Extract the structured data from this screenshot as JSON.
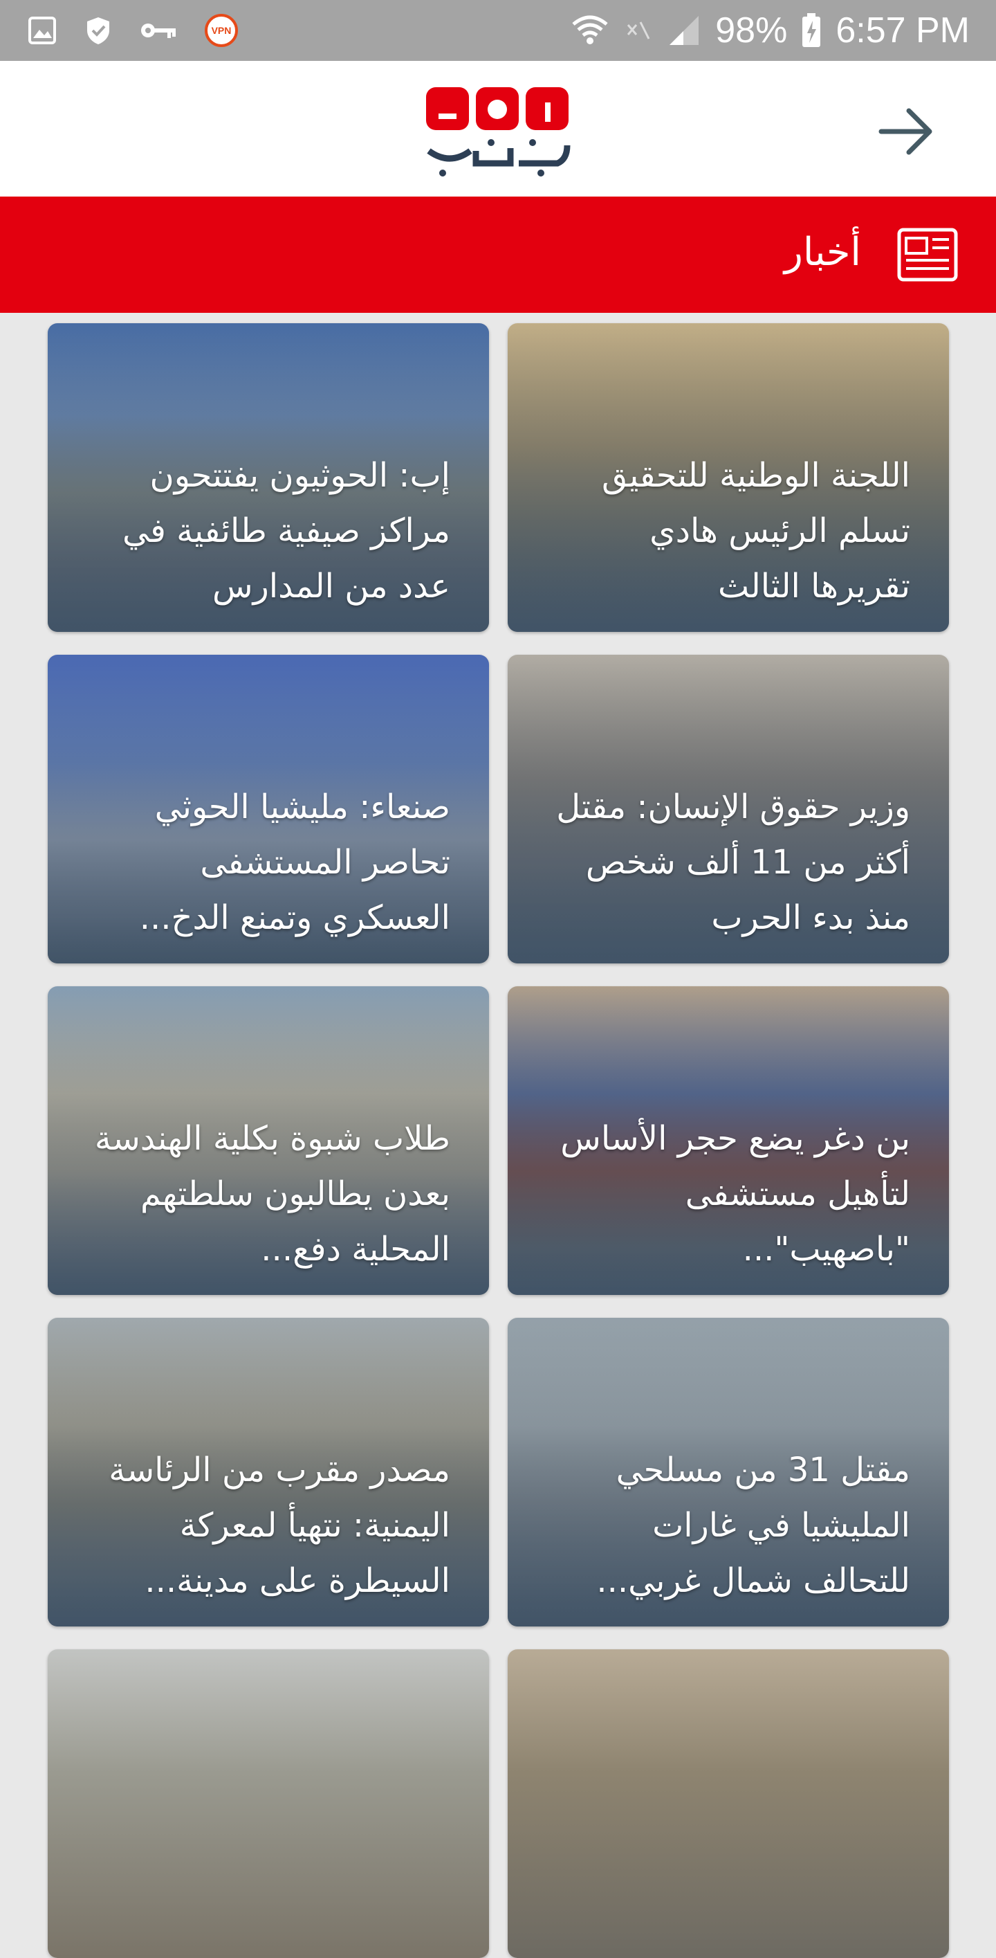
{
  "status_bar": {
    "battery": "98%",
    "time": "6:57 PM",
    "vpn": "VPN",
    "icons": [
      "image-icon",
      "shield-icon",
      "key-icon",
      "vpn-icon",
      "wifi-icon",
      "mute-icon",
      "signal-icon",
      "battery-icon"
    ]
  },
  "app": {
    "accent": "#e3000f"
  },
  "section": {
    "title": "أخبار",
    "icon": "newspaper-icon"
  },
  "articles": [
    {
      "title": "اللجنة الوطنية للتحقيق تسلم الرئيس هادي تقريرها الثالث"
    },
    {
      "title": "إب: الحوثيون يفتتحون مراكز صيفية طائفية في عدد من المدارس"
    },
    {
      "title": "وزير حقوق الإنسان: مقتل أكثر من 11 ألف شخص منذ بدء الحرب"
    },
    {
      "title": "صنعاء: مليشيا الحوثي تحاصر المستشفى العسكري  وتمنع الدخ..."
    },
    {
      "title": "بن دغر يضع حجر الأساس لتأهيل مستشفى \"باصهيب\"..."
    },
    {
      "title": "طلاب شبوة بكلية الهندسة بعدن يطالبون سلطتهم المحلية دفع..."
    },
    {
      "title": "مقتل 31 من مسلحي المليشيا في غارات للتحالف شمال غربي..."
    },
    {
      "title": "مصدر مقرب من الرئاسة اليمنية: نتهيأ لمعركة السيطرة على مدينة..."
    }
  ]
}
